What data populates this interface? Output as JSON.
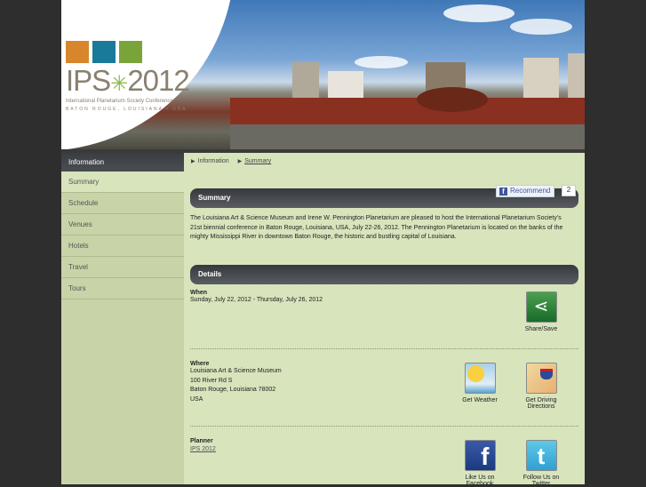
{
  "header": {
    "logo_title": "IPS",
    "logo_year": "2012",
    "logo_subtitle": "International Planetarium Society Conference",
    "logo_location": "BATON ROUGE, LOUISIANA • USA"
  },
  "sidebar": {
    "heading": "Information",
    "items": [
      {
        "label": "Summary",
        "active": true
      },
      {
        "label": "Schedule"
      },
      {
        "label": "Venues"
      },
      {
        "label": "Hotels"
      },
      {
        "label": "Travel"
      },
      {
        "label": "Tours"
      }
    ]
  },
  "breadcrumb": [
    "Information",
    "Summary"
  ],
  "summary": {
    "title": "Summary",
    "recommend_label": "Recommend",
    "recommend_count": "2",
    "text": "The Louisiana Art & Science Museum and Irene W. Pennington Planetarium are pleased to host the International Planetarium Society's 21st biennial conference in Baton Rouge, Louisiana, USA, July 22-26, 2012. The Pennington Planetarium is located on the banks of the mighty Mississippi River in downtown Baton Rouge, the historic and bustling capital of Louisiana."
  },
  "details": {
    "title": "Details",
    "when": {
      "label": "When",
      "value": "Sunday, July 22, 2012 - Thursday, July 26, 2012"
    },
    "where": {
      "label": "Where",
      "lines": [
        "Louisiana Art & Science Museum",
        "100 River Rd S",
        "Baton Rouge, Louisiana 78002",
        "USA"
      ]
    },
    "planner": {
      "label": "Planner",
      "link": "IPS 2012"
    },
    "actions": {
      "share": "Share/Save",
      "weather": "Get Weather",
      "directions": "Get Driving Directions",
      "facebook": "Like Us on Facebook",
      "twitter": "Follow Us on Twitter"
    }
  }
}
